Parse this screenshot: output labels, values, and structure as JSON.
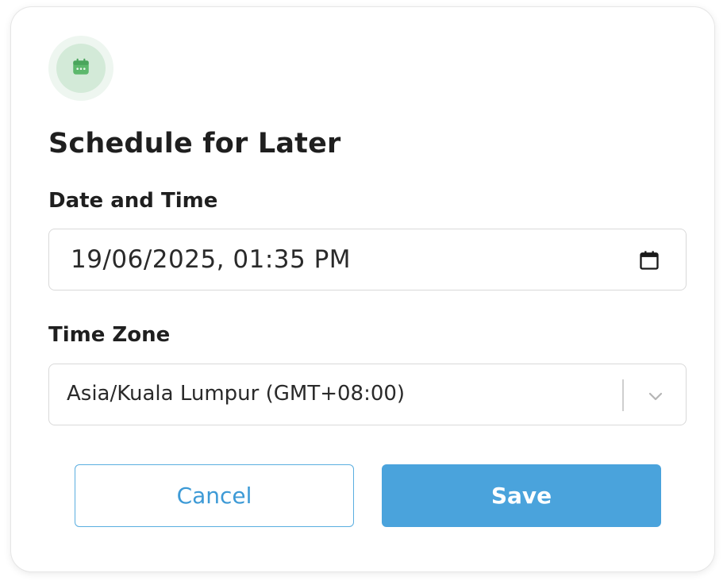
{
  "dialog": {
    "header_icon": "calendar-icon",
    "title": "Schedule for Later"
  },
  "date_time": {
    "label": "Date and Time",
    "value": "19/06/2025, 01:35 PM",
    "picker_icon": "calendar-icon"
  },
  "time_zone": {
    "label": "Time Zone",
    "value": "Asia/Kuala Lumpur (GMT+08:00)",
    "dropdown_icon": "chevron-down-icon"
  },
  "actions": {
    "cancel_label": "Cancel",
    "save_label": "Save"
  },
  "colors": {
    "accent": "#4aa3dc",
    "icon_green": "#5cb86c",
    "text": "#1f1f1f"
  }
}
